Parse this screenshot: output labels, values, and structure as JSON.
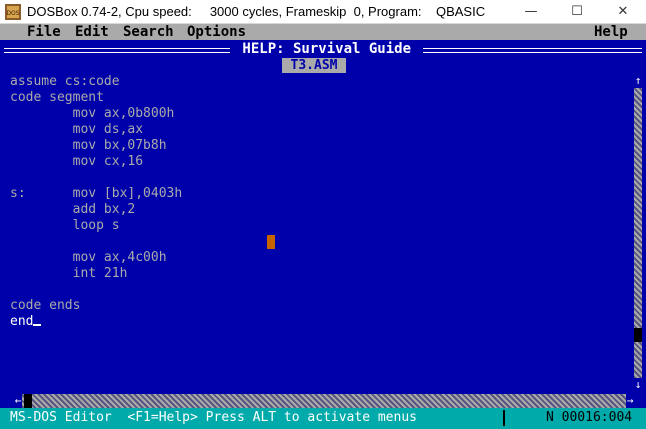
{
  "window": {
    "title": "DOSBox 0.74-2, Cpu speed:     3000 cycles, Frameskip  0, Program:    QBASIC",
    "min_glyph": "—",
    "max_glyph": "☐",
    "close_glyph": "✕",
    "icon": "dosbox-app-icon"
  },
  "menu": {
    "file": "File",
    "edit": "Edit",
    "search": "Search",
    "options": "Options",
    "help": "Help"
  },
  "help_window": {
    "title": " HELP: Survival Guide ",
    "tab": "T3.ASM"
  },
  "code": {
    "lines": [
      "assume cs:code",
      "code segment",
      "        mov ax,0b800h",
      "        mov ds,ax",
      "        mov bx,07b8h",
      "        mov cx,16",
      "",
      "s:      mov [bx],0403h",
      "        add bx,2",
      "        loop s",
      "",
      "        mov ax,4c00h",
      "        int 21h",
      "",
      "code ends",
      "end"
    ]
  },
  "scroll": {
    "up": "↑",
    "down": "↓",
    "left": "←",
    "right": "→"
  },
  "status": {
    "text": "MS-DOS Editor  <F1=Help> Press ALT to activate menus",
    "position": "N 00016:004"
  },
  "colors": {
    "dos_blue": "#0000aa",
    "menu_gray": "#aaaaaa",
    "status_cyan": "#00aaaa",
    "cursor_orange": "#c86400"
  }
}
